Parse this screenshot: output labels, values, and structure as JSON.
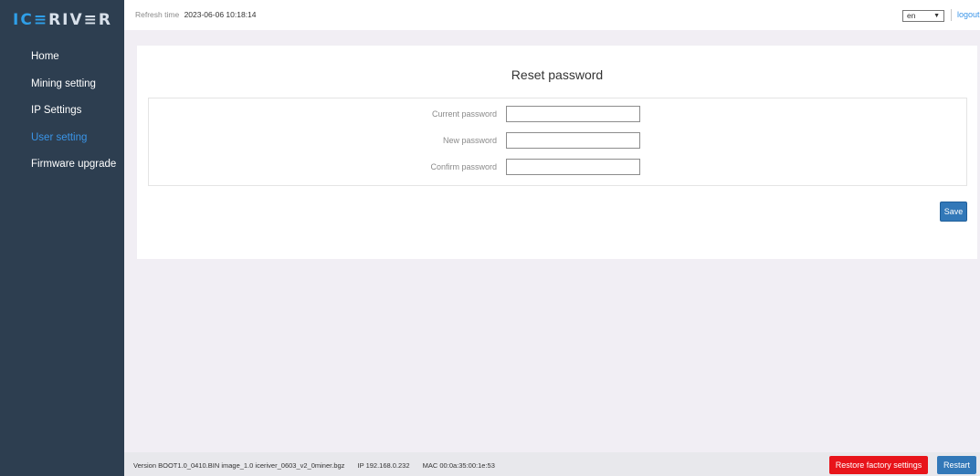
{
  "brand": {
    "logo_text_a": "IC",
    "logo_text_b": "≡",
    "logo_text_c": "RIV",
    "logo_text_d": "≡",
    "logo_text_e": "R"
  },
  "sidebar": {
    "items": [
      {
        "label": "Home"
      },
      {
        "label": "Mining setting"
      },
      {
        "label": "IP Settings"
      },
      {
        "label": "User setting"
      },
      {
        "label": "Firmware upgrade"
      }
    ],
    "active_index": 3
  },
  "header": {
    "refresh_label": "Refresh time",
    "refresh_time": "2023-06-06 10:18:14",
    "language": "en",
    "logout_label": "logout"
  },
  "form": {
    "title": "Reset password",
    "fields": [
      {
        "label": "Current password",
        "value": ""
      },
      {
        "label": "New password",
        "value": ""
      },
      {
        "label": "Confirm password",
        "value": ""
      }
    ],
    "save_label": "Save"
  },
  "footer": {
    "version_label": "Version",
    "version_value": "BOOT1.0_0410.BIN image_1.0 iceriver_0603_v2_0miner.bgz",
    "ip_label": "IP",
    "ip_value": "192.168.0.232",
    "mac_label": "MAC",
    "mac_value": "00:0a:35:00:1e:53",
    "restore_label": "Restore factory settings",
    "restart_label": "Restart"
  },
  "colors": {
    "sidebar_bg": "#2d3e50",
    "accent": "#3a95e8",
    "primary_button": "#3278b8",
    "danger_button": "#e8141a"
  }
}
